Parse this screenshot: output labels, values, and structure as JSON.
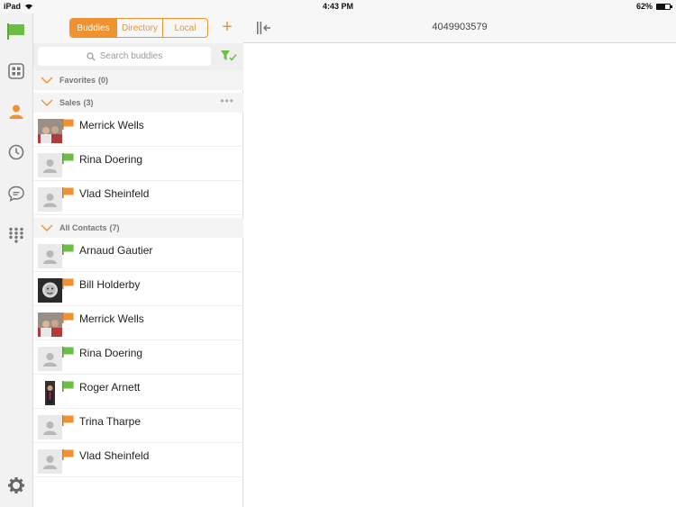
{
  "status_bar": {
    "device": "iPad",
    "time": "4:43 PM",
    "battery": "62%"
  },
  "rail": {
    "icons": [
      "flag-icon",
      "dashboard-icon",
      "contacts-icon",
      "history-icon",
      "chat-icon",
      "dialpad-icon",
      "settings-icon"
    ]
  },
  "tabs": [
    "Buddies",
    "Directory",
    "Local"
  ],
  "active_tab": "Buddies",
  "search": {
    "placeholder": "Search buddies"
  },
  "groups": [
    {
      "name": "Favorites",
      "count": "(0)"
    },
    {
      "name": "Sales",
      "count": "(3)"
    },
    {
      "name": "All Contacts",
      "count": "(7)"
    }
  ],
  "sales_contacts": [
    {
      "name": "Merrick Wells",
      "status": "away"
    },
    {
      "name": "Rina Doering",
      "status": "available"
    },
    {
      "name": "Vlad Sheinfeld",
      "status": "away"
    }
  ],
  "all_contacts": [
    {
      "name": "Arnaud Gautier",
      "status": "available"
    },
    {
      "name": "Bill Holderby",
      "status": "away"
    },
    {
      "name": "Merrick Wells",
      "status": "away"
    },
    {
      "name": "Rina Doering",
      "status": "available"
    },
    {
      "name": "Roger Arnett",
      "status": "available"
    },
    {
      "name": "Trina Tharpe",
      "status": "away"
    },
    {
      "name": "Vlad Sheinfeld",
      "status": "away"
    }
  ],
  "main": {
    "title": "4049903579"
  },
  "colors": {
    "accent": "#f0922f",
    "available": "#6cbd45",
    "away": "#f0922f"
  }
}
